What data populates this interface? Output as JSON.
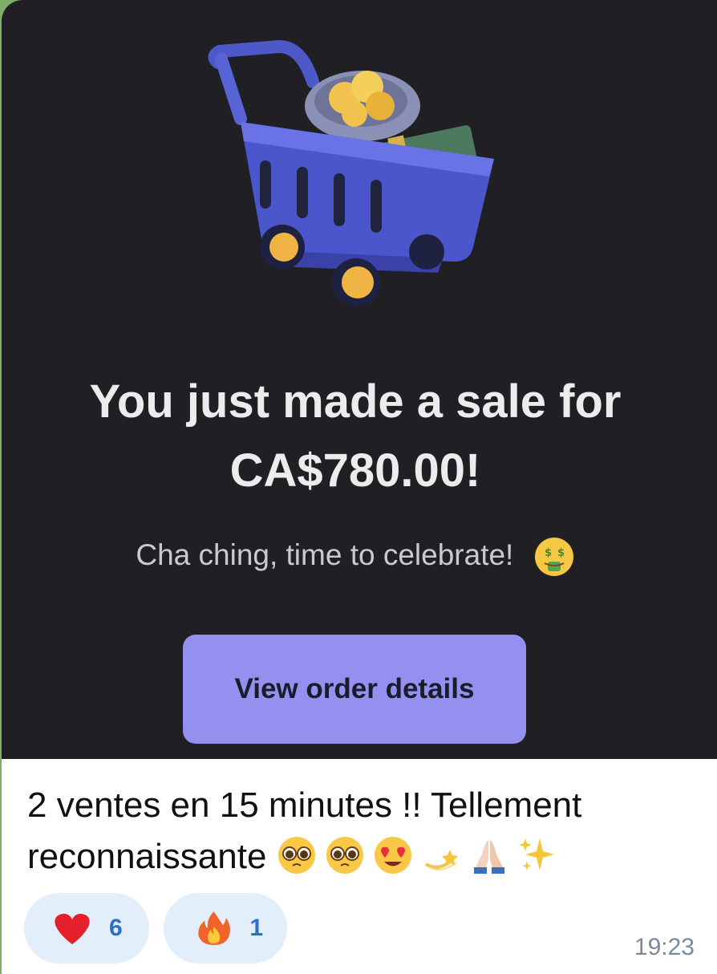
{
  "notification": {
    "image_icon": "shopping-cart-with-coins-and-cash",
    "headline": "You just made a sale for CA$780.00!",
    "subline": "Cha ching, time to celebrate!",
    "subline_emoji": "money-mouth-face-icon",
    "button_label": "View order details"
  },
  "message": {
    "caption": "2 ventes en 15 minutes !! Tellement reconnaissante",
    "caption_emojis": [
      "pleading-face-icon",
      "pleading-face-icon",
      "heart-eyes-face-icon",
      "dizzy-icon",
      "folded-hands-icon",
      "sparkles-icon"
    ],
    "time": "19:23"
  },
  "reactions": [
    {
      "icon": "heart-icon",
      "count": "6"
    },
    {
      "icon": "fire-icon",
      "count": "1"
    }
  ],
  "colors": {
    "media_bg": "#202024",
    "button_bg": "#9390f0",
    "reaction_bg": "#e3eefb",
    "reaction_count": "#2c6fc8",
    "chat_bg": "#7fae6a"
  }
}
